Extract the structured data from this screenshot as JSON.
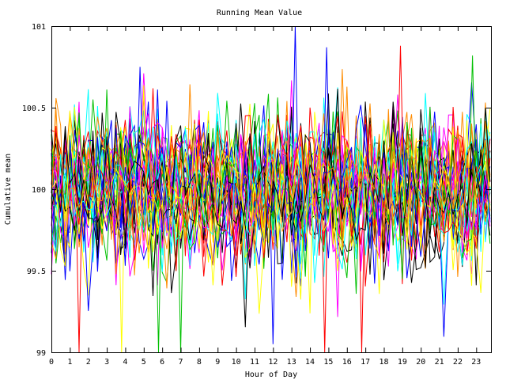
{
  "chart_data": {
    "type": "line",
    "title": "Running Mean Value",
    "xlabel": "Hour of Day",
    "ylabel": "Cumulative mean",
    "xlim": [
      0,
      23.8
    ],
    "ylim": [
      99,
      101
    ],
    "xticks": [
      "0",
      "1",
      "2",
      "3",
      "4",
      "5",
      "6",
      "7",
      "8",
      "9",
      "10",
      "11",
      "12",
      "13",
      "14",
      "15",
      "16",
      "17",
      "18",
      "19",
      "20",
      "21",
      "22",
      "23"
    ],
    "yticks": [
      "99",
      "99.5",
      "100",
      "100.5",
      "101"
    ],
    "grid": false,
    "legend": "none",
    "colors": [
      "#ff0000",
      "#00c000",
      "#0000ff",
      "#ff00ff",
      "#00ffff",
      "#ffff00",
      "#000000",
      "#ff8c00"
    ],
    "series_count": 40,
    "samples_per_hour": 4,
    "center_value": 100,
    "typical_band": [
      99.7,
      100.3
    ],
    "notable_values": [
      {
        "x": 13.2,
        "y": 101.0
      },
      {
        "x": 12.0,
        "y": 99.05
      },
      {
        "x": 1.5,
        "y": 99.0
      },
      {
        "x": 3.8,
        "y": 99.0
      },
      {
        "x": 5.8,
        "y": 99.0
      },
      {
        "x": 7.0,
        "y": 99.0
      },
      {
        "x": 14.8,
        "y": 99.0
      },
      {
        "x": 16.8,
        "y": 99.0
      },
      {
        "x": 18.9,
        "y": 100.88
      },
      {
        "x": 22.8,
        "y": 100.82
      },
      {
        "x": 4.8,
        "y": 100.75
      },
      {
        "x": 14.9,
        "y": 100.87
      }
    ]
  }
}
